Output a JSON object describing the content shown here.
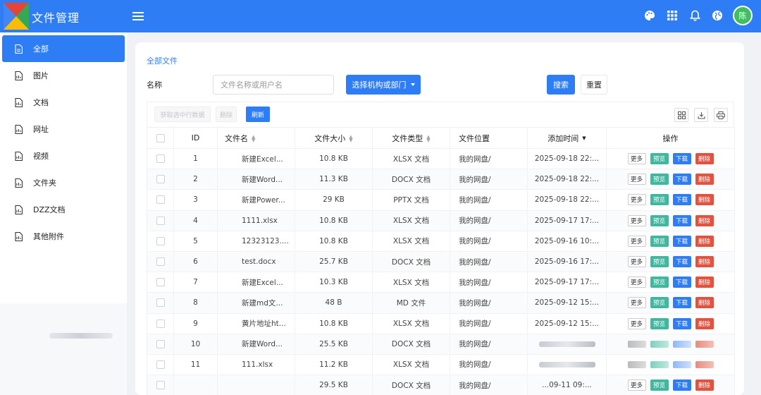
{
  "header": {
    "app_title": "文件管理",
    "avatar_text": "陈",
    "icons": [
      "palette-icon",
      "grid-icon",
      "bell-icon",
      "globe-icon"
    ],
    "brand_color": "#2f7df4"
  },
  "sidebar": {
    "items": [
      {
        "label": "全部",
        "active": true
      },
      {
        "label": "图片",
        "active": false
      },
      {
        "label": "文档",
        "active": false
      },
      {
        "label": "网址",
        "active": false
      },
      {
        "label": "视频",
        "active": false
      },
      {
        "label": "文件夹",
        "active": false
      },
      {
        "label": "DZZ文档",
        "active": false
      },
      {
        "label": "其他附件",
        "active": false
      }
    ]
  },
  "main": {
    "breadcrumb": "全部文件",
    "search": {
      "label": "名称",
      "placeholder": "文件名称或用户名",
      "org_button": "选择机构或部门",
      "search_button": "搜索",
      "reset_button": "重置"
    },
    "toolbar": {
      "get_selected": "获取选中行数据",
      "delete": "删除",
      "refresh": "刷新"
    },
    "table": {
      "columns": [
        "ID",
        "文件名",
        "文件大小",
        "文件类型",
        "文件位置",
        "添加时间",
        "操作"
      ],
      "actions": {
        "more": "更多",
        "preview": "预览",
        "download": "下载",
        "delete": "删除"
      },
      "rows": [
        {
          "id": "1",
          "name": "新建Excel...",
          "size": "10.8 KB",
          "type": "XLSX 文档",
          "location": "我的网盘/",
          "time": "2025-09-18 22:..."
        },
        {
          "id": "2",
          "name": "新建Word...",
          "size": "11.3 KB",
          "type": "DOCX 文档",
          "location": "我的网盘/",
          "time": "2025-09-18 22:..."
        },
        {
          "id": "3",
          "name": "新建Power...",
          "size": "29 KB",
          "type": "PPTX 文档",
          "location": "我的网盘/",
          "time": "2025-09-18 22:..."
        },
        {
          "id": "4",
          "name": "1111.xlsx",
          "size": "10.8 KB",
          "type": "XLSX 文档",
          "location": "我的网盘/",
          "time": "2025-09-17 17:..."
        },
        {
          "id": "5",
          "name": "12323123....",
          "size": "10.8 KB",
          "type": "XLSX 文档",
          "location": "我的网盘/",
          "time": "2025-09-16 10:..."
        },
        {
          "id": "6",
          "name": "test.docx",
          "size": "25.7 KB",
          "type": "DOCX 文档",
          "location": "我的网盘/",
          "time": "2025-09-16 17:..."
        },
        {
          "id": "7",
          "name": "新建Excel...",
          "size": "10.3 KB",
          "type": "XLSX 文档",
          "location": "我的网盘/",
          "time": "2025-09-17 17:..."
        },
        {
          "id": "8",
          "name": "新建md文...",
          "size": "48 B",
          "type": "MD 文件",
          "location": "我的网盘/",
          "time": "2025-09-12 15:..."
        },
        {
          "id": "9",
          "name": "黄片地址ht...",
          "size": "10.8 KB",
          "type": "XLSX 文档",
          "location": "我的网盘/",
          "time": "2025-09-12 15:..."
        },
        {
          "id": "10",
          "name": "新建Word...",
          "size": "25.5 KB",
          "type": "DOCX 文档",
          "location": "我的网盘/",
          "time": ""
        },
        {
          "id": "11",
          "name": "111.xlsx",
          "size": "11.2 KB",
          "type": "XLSX 文档",
          "location": "我的网盘/",
          "time": ""
        },
        {
          "id": "",
          "name": "",
          "size": "29.5 KB",
          "type": "DOCX 文档",
          "location": "我的网盘/",
          "time": "...09-11 09:..."
        }
      ]
    }
  }
}
